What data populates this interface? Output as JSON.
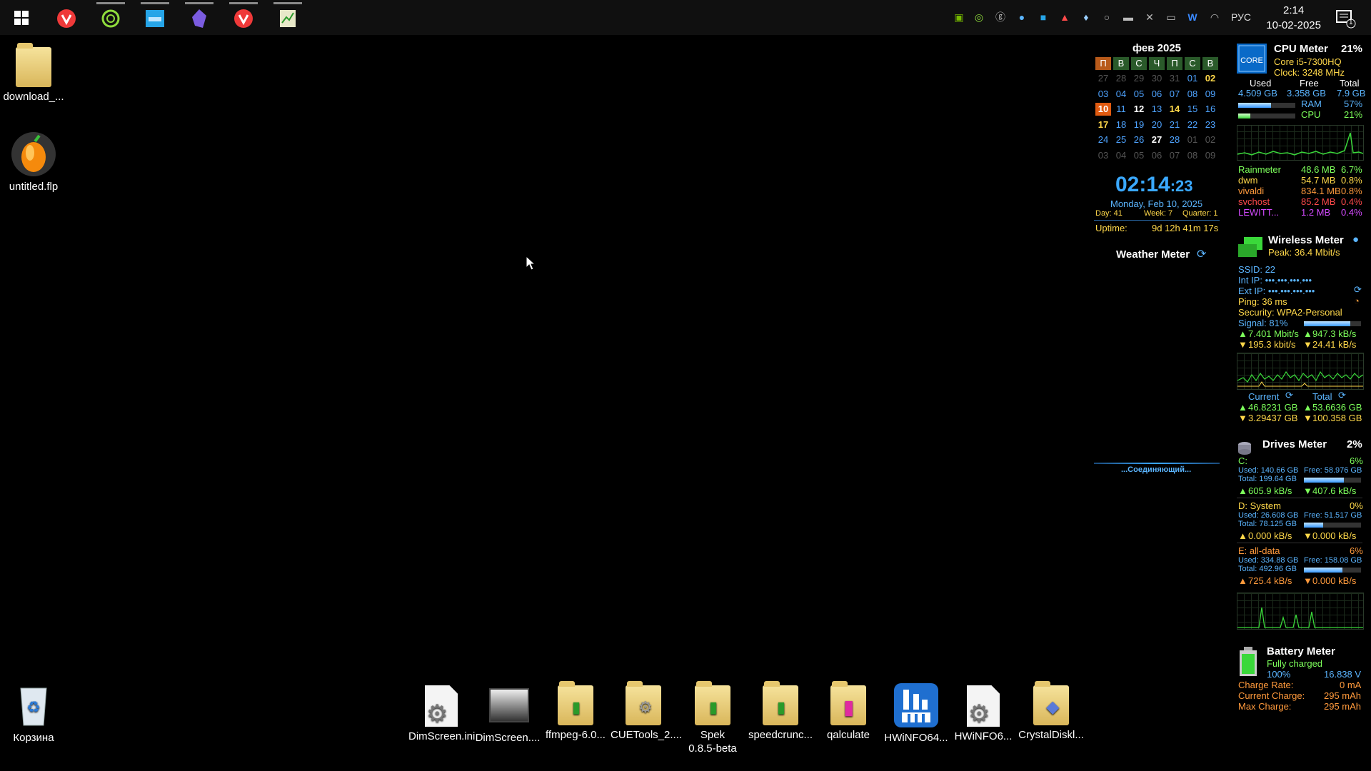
{
  "taskbar": {
    "clock_time": "2:14",
    "clock_date": "10-02-2025",
    "language": "РУС",
    "notification_count": "1"
  },
  "desktop_icons": {
    "download": "download_...",
    "flp": "untitled.flp",
    "recycle": "Корзина",
    "dimscreen_ini": "DimScreen.ini",
    "dimscreen": "DimScreen....",
    "ffmpeg": "ffmpeg-6.0...",
    "cuetools": "CUETools_2....",
    "spek_line1": "Spek",
    "spek_line2": "0.8.5-beta",
    "speedcrunch": "speedcrunc...",
    "qalculate": "qalculate",
    "hwinfo64": "HWiNFO64...",
    "hwinfo6": "HWiNFO6...",
    "crystaldisk": "CrystalDiskl..."
  },
  "calendar": {
    "month": "фев 2025",
    "weekdays": [
      "П",
      "В",
      "С",
      "Ч",
      "П",
      "С",
      "В"
    ],
    "rows": [
      [
        "27",
        "28",
        "29",
        "30",
        "31",
        "01",
        "02"
      ],
      [
        "03",
        "04",
        "05",
        "06",
        "07",
        "08",
        "09"
      ],
      [
        "10",
        "11",
        "12",
        "13",
        "14",
        "15",
        "16"
      ],
      [
        "17",
        "18",
        "19",
        "20",
        "21",
        "22",
        "23"
      ],
      [
        "24",
        "25",
        "26",
        "27",
        "28",
        "01",
        "02"
      ],
      [
        "03",
        "04",
        "05",
        "06",
        "07",
        "08",
        "09"
      ]
    ]
  },
  "clock_widget": {
    "time_hm": "02:14",
    "time_s": ":23",
    "date": "Monday, Feb 10, 2025",
    "day": "Day: 41",
    "week": "Week: 7",
    "quarter": "Quarter: 1",
    "uptime_label": "Uptime:",
    "uptime_value": "9d 12h 41m 17s"
  },
  "weather": {
    "title": "Weather Meter",
    "status": "...Соединяющий..."
  },
  "cpu_meter": {
    "title": "CPU Meter",
    "percent": "21%",
    "cpu_name": "Core i5-7300HQ",
    "clock": "Clock: 3248 MHz",
    "used_label": "Used",
    "free_label": "Free",
    "total_label": "Total",
    "used": "4.509 GB",
    "free": "3.358 GB",
    "total": "7.9 GB",
    "ram_label": "RAM",
    "ram_pct": "57%",
    "ram_fill": 0.57,
    "cpu_label": "CPU",
    "cpu_pct": "21%",
    "cpu_fill": 0.21,
    "processes": [
      {
        "name": "Rainmeter",
        "mem": "48.6 MB",
        "cpu": "6.7%",
        "color": "#7dff5b"
      },
      {
        "name": "dwm",
        "mem": "54.7 MB",
        "cpu": "0.8%",
        "color": "#ffd84a"
      },
      {
        "name": "vivaldi",
        "mem": "834.1 MB",
        "cpu": "0.8%",
        "color": "#ff9a3c"
      },
      {
        "name": "svchost",
        "mem": "85.2 MB",
        "cpu": "0.4%",
        "color": "#ff4a4a"
      },
      {
        "name": "LEWITT...",
        "mem": "1.2 MB",
        "cpu": "0.4%",
        "color": "#d44aff"
      }
    ]
  },
  "wireless_meter": {
    "title": "Wireless Meter",
    "peak": "Peak: 36.4 Mbit/s",
    "ssid": "SSID:  22",
    "int_ip": "Int IP:  •••.•••.•••.•••",
    "ext_ip": "Ext IP:  •••.•••.•••.•••",
    "ping": "Ping:  36 ms",
    "security": "Security:  WPA2-Personal",
    "signal": "Signal:  81%",
    "signal_fill": 0.81,
    "up_rate": "7.401 Mbit/s",
    "up_bytes": "947.3 kB/s",
    "down_rate": "195.3 kbit/s",
    "down_bytes": "24.41 kB/s",
    "current_label": "Current",
    "total_label": "Total",
    "cur_up": "46.8231 GB",
    "cur_down": "3.29437 GB",
    "tot_up": "53.6636 GB",
    "tot_down": "100.358 GB"
  },
  "drives_meter": {
    "title": "Drives Meter",
    "percent": "2%",
    "drives": [
      {
        "name": "C:",
        "pct": "6%",
        "used": "Used: 140.66 GB",
        "free": "Free: 58.976 GB",
        "total": "Total: 199.64 GB",
        "fill": 0.7,
        "up": "605.9 kB/s",
        "down": "407.6 kB/s",
        "color": "#7dff5b"
      },
      {
        "name": "D: System",
        "pct": "0%",
        "used": "Used: 26.608 GB",
        "free": "Free: 51.517 GB",
        "total": "Total: 78.125 GB",
        "fill": 0.34,
        "up": "0.000 kB/s",
        "down": "0.000 kB/s",
        "color": "#ffd84a"
      },
      {
        "name": "E: all-data",
        "pct": "6%",
        "used": "Used: 334.88 GB",
        "free": "Free: 158.08 GB",
        "total": "Total: 492.96 GB",
        "fill": 0.68,
        "up": "725.4 kB/s",
        "down": "0.000 kB/s",
        "color": "#ff9a3c"
      }
    ]
  },
  "battery_meter": {
    "title": "Battery Meter",
    "status": "Fully charged",
    "percent": "100%",
    "voltage": "16.838 V",
    "charge_rate_label": "Charge Rate:",
    "charge_rate": "0 mA",
    "current_charge_label": "Current Charge:",
    "current_charge": "295 mAh",
    "max_charge_label": "Max Charge:",
    "max_charge": "295 mAh"
  }
}
